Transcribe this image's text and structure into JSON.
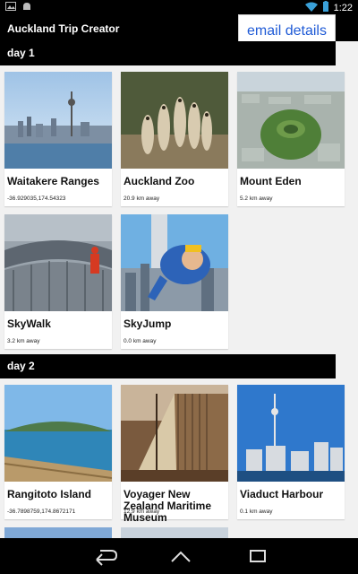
{
  "status": {
    "time": "1:22",
    "icons": [
      "photo-icon",
      "android-icon",
      "wifi-icon",
      "battery-icon"
    ]
  },
  "app": {
    "title": "Auckland Trip Creator",
    "email_label": "email details"
  },
  "days": [
    {
      "label": "day 1",
      "cards": [
        {
          "title": "Waitakere Ranges",
          "dist": "-36.929035,174.54323"
        },
        {
          "title": "Auckland Zoo",
          "dist": "20.9 km away"
        },
        {
          "title": "Mount Eden",
          "dist": "5.2 km away"
        },
        {
          "title": "SkyWalk",
          "dist": "3.2 km away"
        },
        {
          "title": "SkyJump",
          "dist": "0.0 km away"
        }
      ]
    },
    {
      "label": "day 2",
      "cards": [
        {
          "title": "Rangitoto Island",
          "dist": "-36.7898759,174.8672171"
        },
        {
          "title": "Voyager New Zealand Maritime Museum",
          "dist": "12.9 km away"
        },
        {
          "title": "Viaduct Harbour",
          "dist": "0.1 km away"
        }
      ]
    }
  ]
}
